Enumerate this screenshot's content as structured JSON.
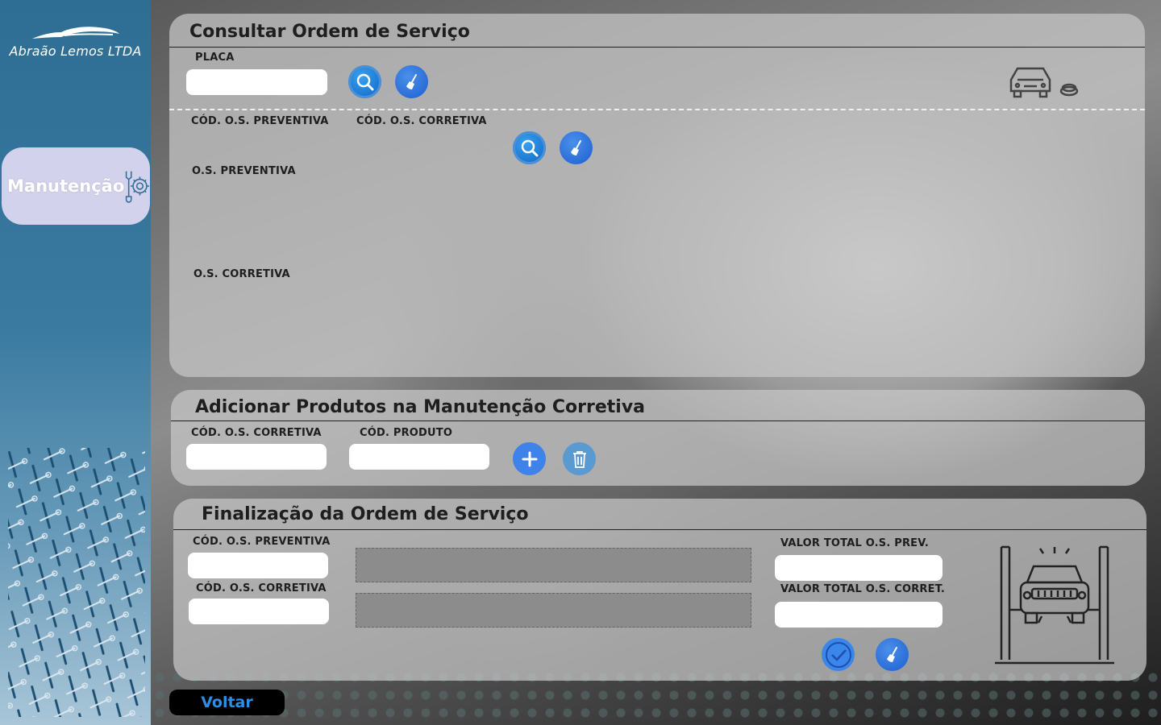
{
  "brand": {
    "name": "Abraão Lemos LTDA",
    "logo_icon": "car-silhouette-icon"
  },
  "sidebar": {
    "items": [
      {
        "label": "Manutenção",
        "icon": "wrench-gear-icon"
      }
    ]
  },
  "consultar": {
    "title": "Consultar Ordem de Serviço",
    "placa_label": "PLACA",
    "placa_value": "",
    "cod_preventiva_label": "CÓD. O.S. PREVENTIVA",
    "cod_corretiva_label": "CÓD. O.S. CORRETIVA",
    "os_preventiva_label": "O.S. PREVENTIVA",
    "os_corretiva_label": "O.S. CORRETIVA"
  },
  "adicionar": {
    "title": "Adicionar Produtos na Manutenção Corretiva",
    "cod_corretiva_label": "CÓD. O.S. CORRETIVA",
    "cod_produto_label": "CÓD. PRODUTO",
    "cod_corretiva_value": "",
    "cod_produto_value": ""
  },
  "finalizacao": {
    "title": "Finalização da Ordem de Serviço",
    "cod_preventiva_label": "CÓD. O.S. PREVENTIVA",
    "cod_corretiva_label": "CÓD. O.S. CORRETIVA",
    "valor_prev_label": "VALOR TOTAL O.S. PREV.",
    "valor_corret_label": "VALOR TOTAL O.S. CORRET.",
    "cod_preventiva_value": "",
    "cod_corretiva_value": "",
    "valor_prev_value": "",
    "valor_corret_value": ""
  },
  "footer": {
    "voltar_label": "Voltar"
  },
  "colors": {
    "accent": "#3b86ea",
    "sidebar": "#2f6e94",
    "nav_active": "#d3d2ec"
  }
}
